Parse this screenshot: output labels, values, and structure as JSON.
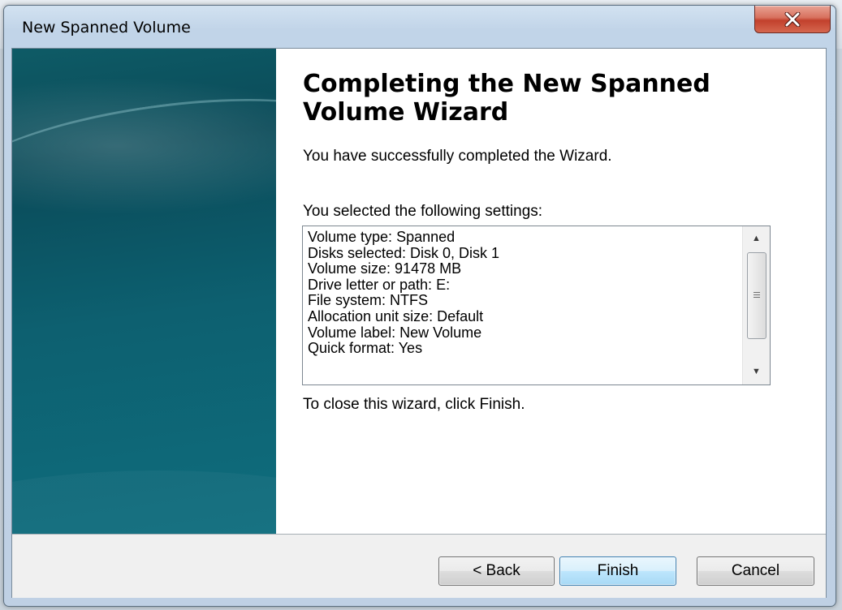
{
  "window": {
    "title": "New Spanned Volume"
  },
  "close_button": {
    "icon": "close-icon",
    "color": "#c2402c"
  },
  "wizard": {
    "heading": "Completing the New Spanned Volume Wizard",
    "success_text": "You have successfully completed the Wizard.",
    "settings_intro": "You selected the following settings:",
    "settings": [
      "Volume type: Spanned",
      "Disks selected: Disk 0, Disk 1",
      "Volume size: 91478 MB",
      "Drive letter or path: E:",
      "File system: NTFS",
      "Allocation unit size: Default",
      "Volume label: New Volume",
      "Quick format: Yes"
    ],
    "close_hint": "To close this wizard, click Finish."
  },
  "buttons": {
    "back": "< Back",
    "finish": "Finish",
    "cancel": "Cancel"
  },
  "scrollbar": {
    "up_icon": "scroll-up-arrow-icon",
    "down_icon": "scroll-down-arrow-icon"
  },
  "colors": {
    "banner": "#0d6070",
    "default_button": "#bee6fd"
  }
}
